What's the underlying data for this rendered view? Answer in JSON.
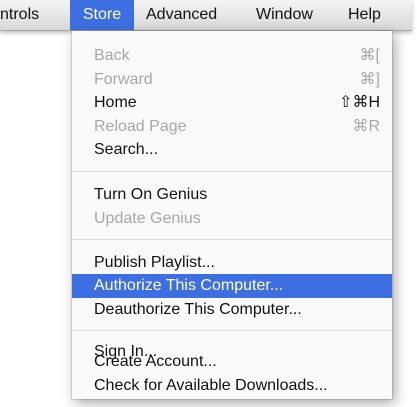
{
  "menubar": {
    "items": [
      {
        "label": "ntrols"
      },
      {
        "label": "Store",
        "active": true
      },
      {
        "label": "Advanced"
      },
      {
        "label": "Window"
      },
      {
        "label": "Help"
      }
    ]
  },
  "store_menu": {
    "items": [
      {
        "label": "Back",
        "shortcut": "⌘[",
        "enabled": false
      },
      {
        "label": "Forward",
        "shortcut": "⌘]",
        "enabled": false
      },
      {
        "label": "Home",
        "shortcut": "⇧⌘H",
        "enabled": true
      },
      {
        "label": "Reload Page",
        "shortcut": "⌘R",
        "enabled": false
      },
      {
        "label": "Search...",
        "enabled": true
      },
      {
        "label": "Turn On Genius",
        "enabled": true
      },
      {
        "label": "Update Genius",
        "enabled": false
      },
      {
        "label": "Publish Playlist...",
        "enabled": true
      },
      {
        "label": "Authorize This Computer...",
        "enabled": true,
        "highlighted": true
      },
      {
        "label": "Deauthorize This Computer...",
        "enabled": true
      },
      {
        "label": "Sign In...",
        "enabled": true
      },
      {
        "label": "Create Account...",
        "enabled": true
      },
      {
        "label": "Check for Available Downloads...",
        "enabled": true
      }
    ]
  },
  "colors": {
    "highlight": "#3e6fe2",
    "disabled_text": "#a7a7a7",
    "text": "#111111"
  }
}
